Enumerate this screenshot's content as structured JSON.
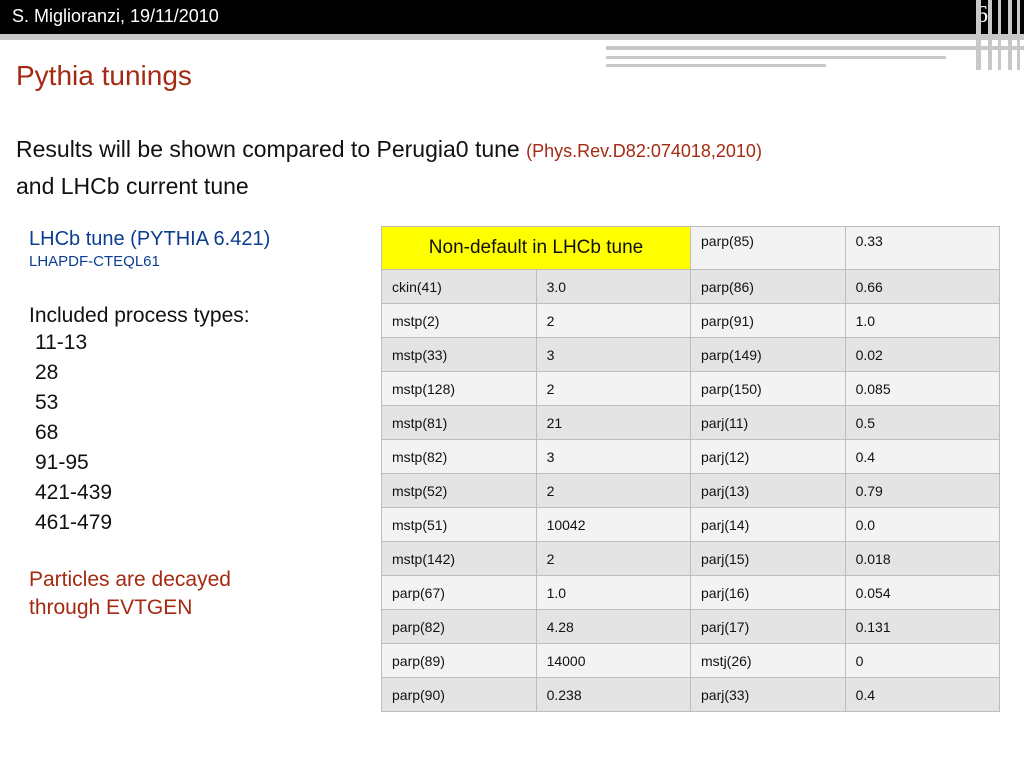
{
  "header": {
    "author_date": "S. Miglioranzi, 19/11/2010",
    "slide_number": "6"
  },
  "title": "Pythia tunings",
  "intro": {
    "line1": "Results will be shown compared to Perugia0 tune",
    "ref": "(Phys.Rev.D82:074018,2010)",
    "line2": "and LHCb current tune"
  },
  "left": {
    "tune": "LHCb tune (PYTHIA 6.421)",
    "pdf": "LHAPDF-CTEQL61",
    "process_title": "Included process types:",
    "processes": [
      "11-13",
      "28",
      "53",
      "68",
      "91-95",
      "421-439",
      "461-479"
    ],
    "decay_line1": "Particles are decayed",
    "decay_line2": "through EVTGEN"
  },
  "table": {
    "header_label": "Non-default in LHCb tune",
    "header_param": "parp(85)",
    "header_value": "0.33",
    "rows": [
      [
        "ckin(41)",
        "3.0",
        "parp(86)",
        "0.66"
      ],
      [
        "mstp(2)",
        "2",
        "parp(91)",
        "1.0"
      ],
      [
        "mstp(33)",
        "3",
        "parp(149)",
        "0.02"
      ],
      [
        "mstp(128)",
        "2",
        "parp(150)",
        "0.085"
      ],
      [
        "mstp(81)",
        "21",
        "parj(11)",
        "0.5"
      ],
      [
        "mstp(82)",
        "3",
        "parj(12)",
        "0.4"
      ],
      [
        "mstp(52)",
        "2",
        "parj(13)",
        "0.79"
      ],
      [
        "mstp(51)",
        "10042",
        "parj(14)",
        "0.0"
      ],
      [
        "mstp(142)",
        "2",
        "parj(15)",
        "0.018"
      ],
      [
        "parp(67)",
        "1.0",
        "parj(16)",
        "0.054"
      ],
      [
        "parp(82)",
        "4.28",
        "parj(17)",
        "0.131"
      ],
      [
        "parp(89)",
        "14000",
        "mstj(26)",
        "0"
      ],
      [
        "parp(90)",
        "0.238",
        "parj(33)",
        "0.4"
      ]
    ]
  }
}
